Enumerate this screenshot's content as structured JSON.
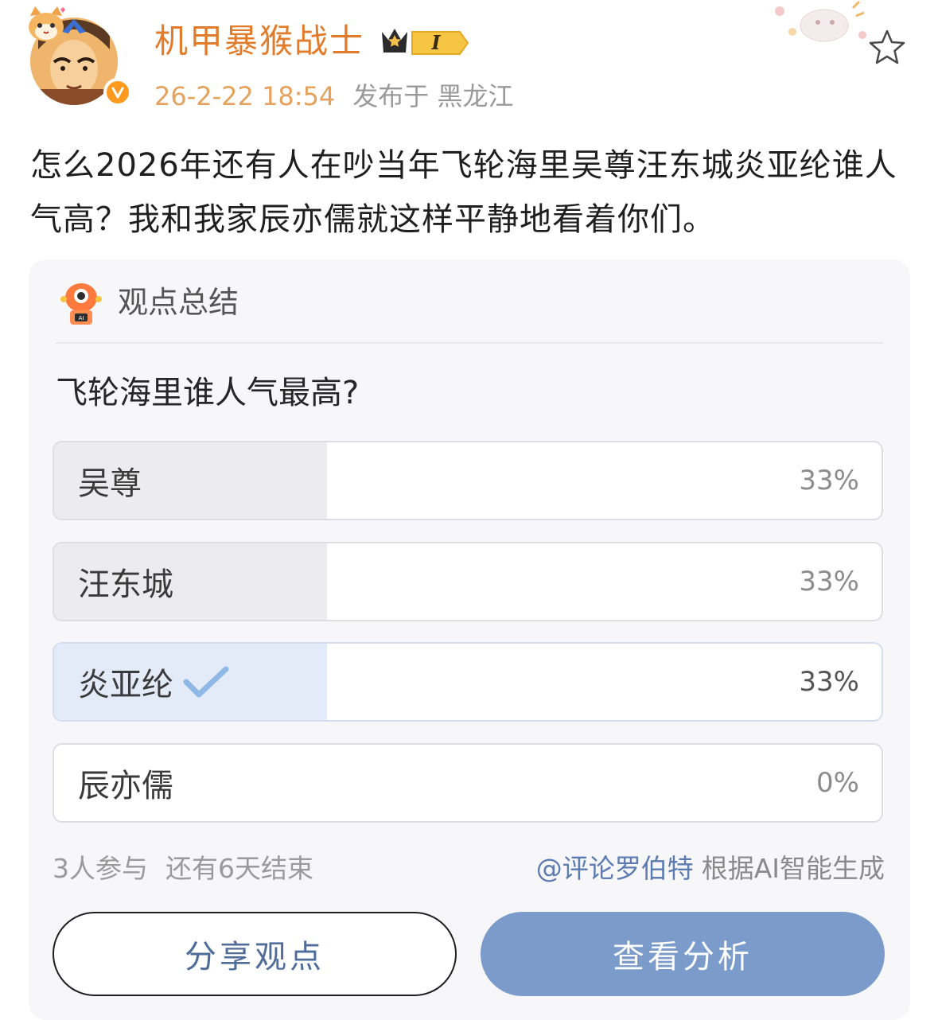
{
  "header": {
    "username": "机甲暴猴战士",
    "vip_level": "I",
    "timestamp": "26-2-22 18:54",
    "location_label": "发布于 黑龙江"
  },
  "post": {
    "text": "怎么2026年还有人在吵当年飞轮海里吴尊汪东城炎亚纶谁人气高？我和我家辰亦儒就这样平静地看着你们。"
  },
  "poll": {
    "card_title": "观点总结",
    "question": "飞轮海里谁人气最高?",
    "options": [
      {
        "label": "吴尊",
        "percent_text": "33%",
        "share": 0.33,
        "selected": false
      },
      {
        "label": "汪东城",
        "percent_text": "33%",
        "share": 0.33,
        "selected": false
      },
      {
        "label": "炎亚纶",
        "percent_text": "33%",
        "share": 0.33,
        "selected": true
      },
      {
        "label": "辰亦儒",
        "percent_text": "0%",
        "share": 0.0,
        "selected": false
      }
    ],
    "participants": "3人参与",
    "time_left": "还有6天结束",
    "ai_mention": "@评论罗伯特",
    "ai_note": "根据AI智能生成",
    "share_button": "分享观点",
    "analyze_button": "查看分析"
  },
  "colors": {
    "username": "#e27c2b",
    "accent_blue": "#7b9bcb",
    "mention_blue": "#5b7bb1",
    "verified_orange": "#ff9a1f"
  },
  "icons": {
    "verified": "verified-v-icon",
    "favorite": "star-outline-icon",
    "selected_mark": "check-icon",
    "bot": "robot-icon"
  }
}
